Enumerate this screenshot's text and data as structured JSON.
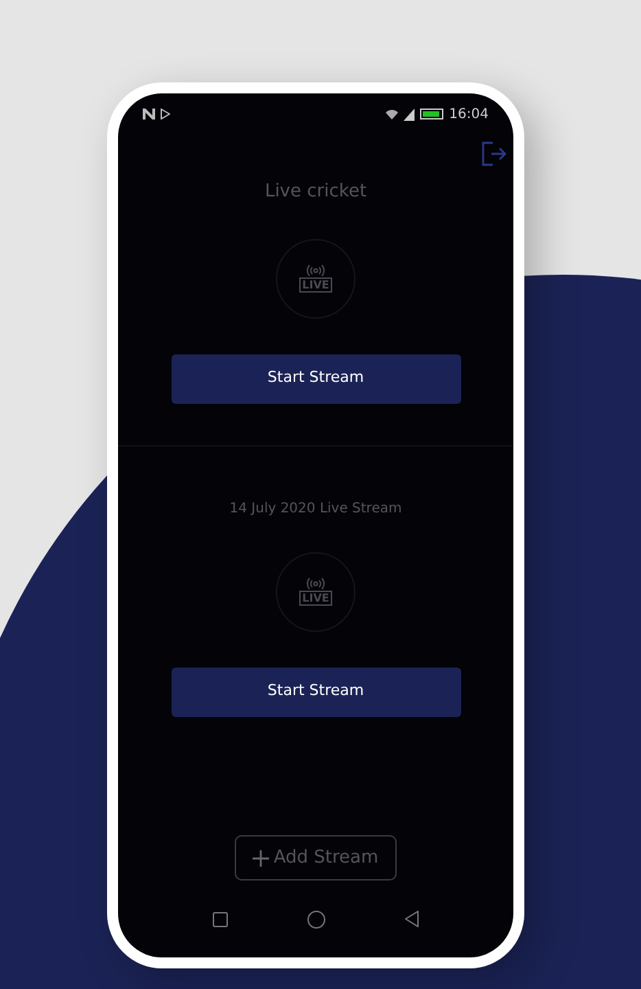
{
  "status_bar": {
    "time": "16:04"
  },
  "streams": [
    {
      "title": "Live cricket",
      "badge": "LIVE",
      "button": "Start Stream"
    },
    {
      "title": "14 July 2020 Live Stream",
      "badge": "LIVE",
      "button": "Start Stream"
    }
  ],
  "add_button": "Add Stream"
}
